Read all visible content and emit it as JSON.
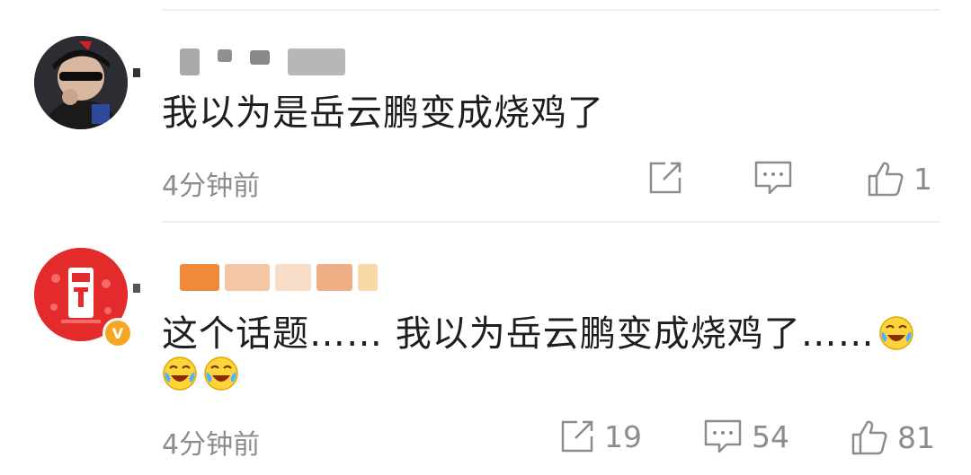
{
  "comments": [
    {
      "username_hidden": true,
      "text": "我以为是岳云鹏变成烧鸡了",
      "time": "4分钟前",
      "share_count": "",
      "reply_count": "",
      "like_count": "1",
      "emojis": []
    },
    {
      "username_hidden": true,
      "text": "这个话题…… 我以为岳云鹏变成烧鸡了……",
      "time": "4分钟前",
      "share_count": "19",
      "reply_count": "54",
      "like_count": "81",
      "verified_badge": "V",
      "emojis": [
        "laugh-cry-icon",
        "laugh-cry-icon",
        "laugh-cry-icon"
      ]
    }
  ],
  "colors": {
    "divider": "#ededed",
    "meta_text": "#8c8c8c",
    "comment_text": "#1e1e1e",
    "badge": "#f5a623",
    "avatar2_bg": "#e32b2b"
  }
}
